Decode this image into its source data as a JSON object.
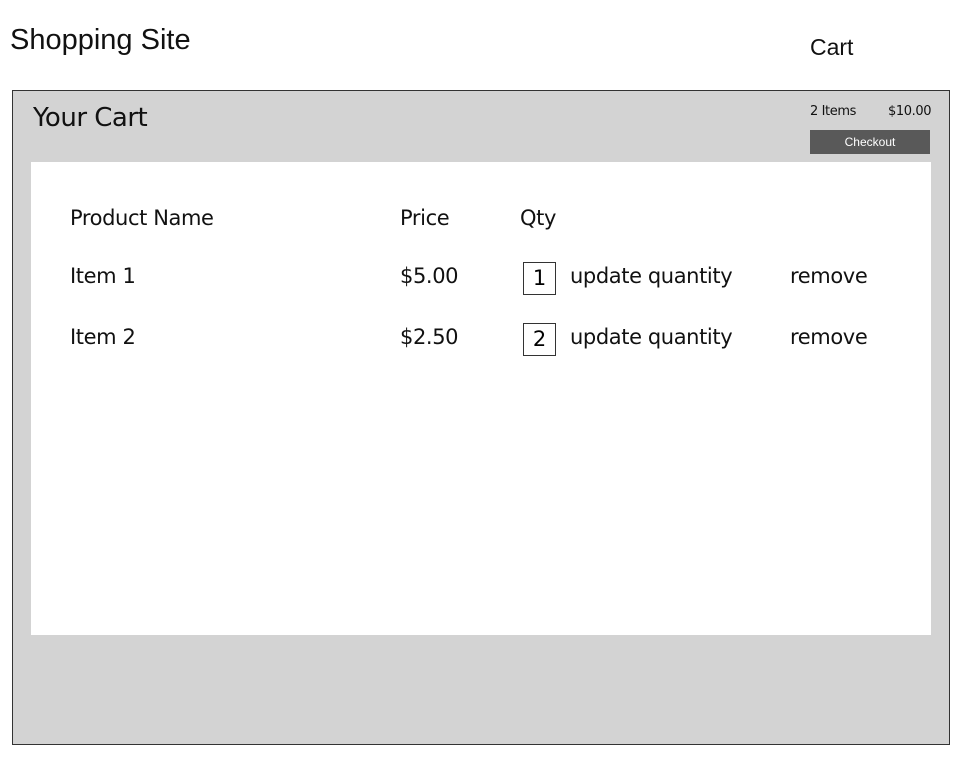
{
  "header": {
    "site_title": "Shopping Site",
    "cart_link": "Cart"
  },
  "cart": {
    "title": "Your Cart",
    "items_count": "2 Items",
    "total": "$10.00",
    "checkout_label": "Checkout",
    "columns": {
      "name": "Product Name",
      "price": "Price",
      "qty": "Qty"
    },
    "rows": [
      {
        "name": "Item 1",
        "price": "$5.00",
        "qty": "1",
        "update": "update quantity",
        "remove": "remove"
      },
      {
        "name": "Item 2",
        "price": "$2.50",
        "qty": "2",
        "update": "update quantity",
        "remove": "remove"
      }
    ]
  }
}
